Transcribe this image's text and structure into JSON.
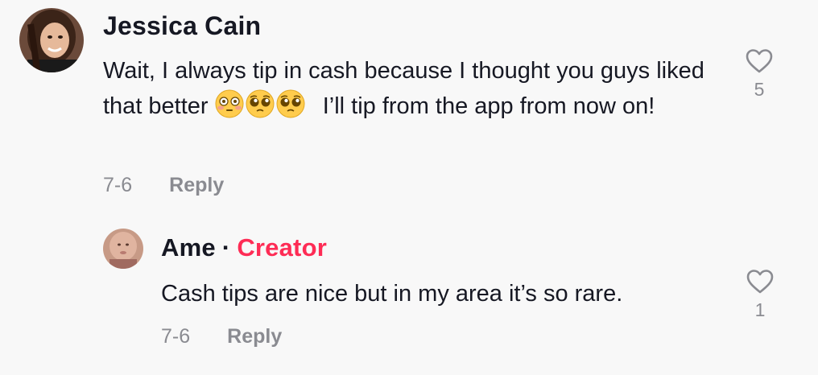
{
  "comments": [
    {
      "username": "Jessica Cain",
      "text_before": "Wait, I always tip in cash because I thought you guys liked that better",
      "emojis": [
        "flushed-face",
        "pleading-face",
        "pleading-face"
      ],
      "text_after": "I’ll tip from the app from now on!",
      "date": "7-6",
      "reply_label": "Reply",
      "likes": "5",
      "icon": "heart-outline-icon"
    },
    {
      "username": "Ame",
      "separator": "·",
      "badge": "Creator",
      "text": "Cash tips are nice but in my area it’s so rare.",
      "date": "7-6",
      "reply_label": "Reply",
      "likes": "1",
      "icon": "heart-outline-icon"
    }
  ],
  "colors": {
    "background": "#f8f8f8",
    "text": "#161823",
    "muted": "#8a8b91",
    "creator": "#fe2c55"
  }
}
